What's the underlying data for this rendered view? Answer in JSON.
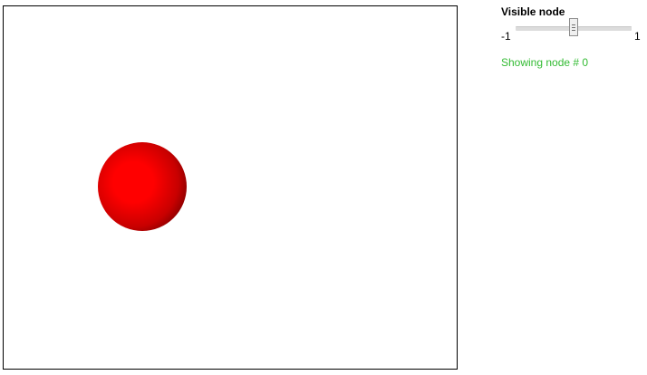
{
  "viewport": {
    "sphere_color": "#ff0000"
  },
  "slider": {
    "title": "Visible node",
    "min": "-1",
    "max": "1",
    "value": 0
  },
  "status": {
    "text": "Showing node # 0",
    "color": "#33bb33"
  }
}
